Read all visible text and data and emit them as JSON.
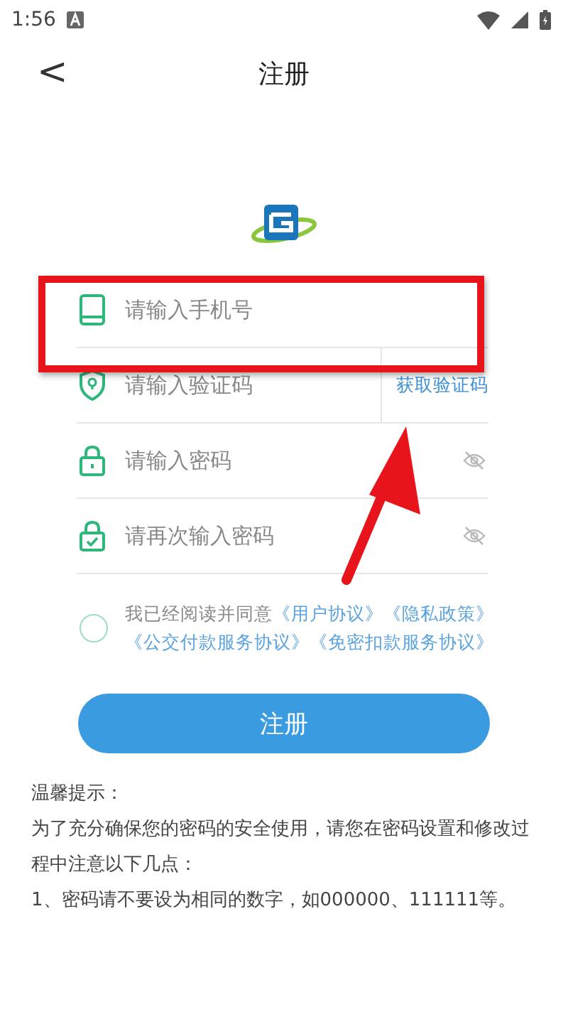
{
  "status_bar": {
    "time": "1:56"
  },
  "header": {
    "back": "<",
    "title": "注册"
  },
  "fields": [
    {
      "kind": "phone",
      "placeholder": "请输入手机号"
    },
    {
      "kind": "code",
      "placeholder": "请输入验证码",
      "action": "获取验证码"
    },
    {
      "kind": "password",
      "placeholder": "请输入密码"
    },
    {
      "kind": "password_confirm",
      "placeholder": "请再次输入密码"
    }
  ],
  "agreement": {
    "checked": false,
    "text": "我已经阅读并同意",
    "links": [
      "《用户协议》",
      "《隐私政策》",
      "《公交付款服务协议》",
      "《免密扣款服务协议》"
    ]
  },
  "submit": "注册",
  "tips": [
    "温馨提示：",
    "为了充分确保您的密码的安全使用，请您在密码设置和修改过程中注意以下几点：",
    "1、密码请不要设为相同的数字，如000000、111111等。"
  ]
}
